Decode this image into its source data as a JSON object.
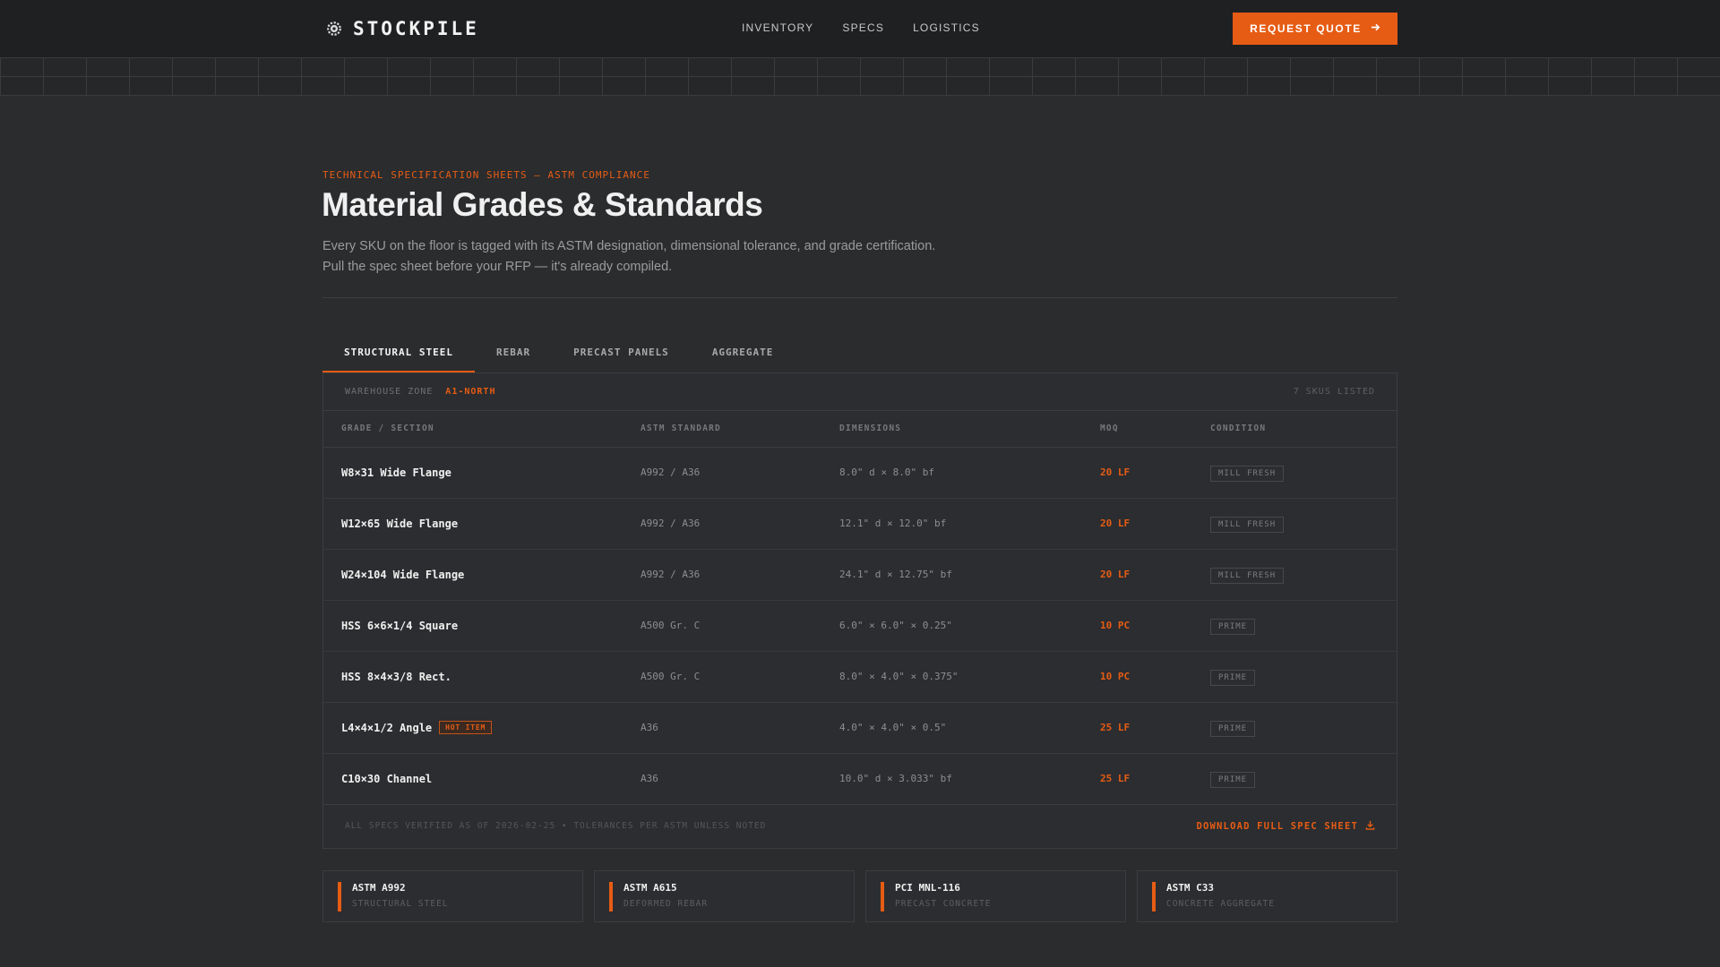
{
  "header": {
    "brand": "STOCKPILE",
    "brand_icon": "gear-icon",
    "nav": [
      "INVENTORY",
      "SPECS",
      "LOGISTICS"
    ],
    "cta_label": "REQUEST QUOTE",
    "cta_icon": "arrow-right-icon"
  },
  "hero": {
    "eyebrow": "TECHNICAL SPECIFICATION SHEETS — ASTM COMPLIANCE",
    "title": "Material Grades & Standards",
    "lead_line1": "Every SKU on the floor is tagged with its ASTM designation, dimensional tolerance, and grade certification.",
    "lead_line2": "Pull the spec sheet before your RFP — it's already compiled."
  },
  "tabs": [
    "STRUCTURAL STEEL",
    "REBAR",
    "PRECAST PANELS",
    "AGGREGATE"
  ],
  "active_tab": 0,
  "zone": {
    "label": "WAREHOUSE ZONE",
    "value": "A1-NORTH",
    "count": "7 SKUS LISTED"
  },
  "table": {
    "columns": [
      "GRADE / SECTION",
      "ASTM STANDARD",
      "DIMENSIONS",
      "MOQ",
      "CONDITION"
    ],
    "rows": [
      {
        "grade": "W8×31 Wide Flange",
        "badge": "",
        "astm": "A992 / A36",
        "dims": "8.0\" d × 8.0\" bf",
        "moq": "20 LF",
        "condition": "MILL FRESH"
      },
      {
        "grade": "W12×65 Wide Flange",
        "badge": "",
        "astm": "A992 / A36",
        "dims": "12.1\" d × 12.0\" bf",
        "moq": "20 LF",
        "condition": "MILL FRESH"
      },
      {
        "grade": "W24×104 Wide Flange",
        "badge": "",
        "astm": "A992 / A36",
        "dims": "24.1\" d × 12.75\" bf",
        "moq": "20 LF",
        "condition": "MILL FRESH"
      },
      {
        "grade": "HSS 6×6×1/4 Square",
        "badge": "",
        "astm": "A500 Gr. C",
        "dims": "6.0\" × 6.0\" × 0.25\"",
        "moq": "10 PC",
        "condition": "PRIME"
      },
      {
        "grade": "HSS 8×4×3/8 Rect.",
        "badge": "",
        "astm": "A500 Gr. C",
        "dims": "8.0\" × 4.0\" × 0.375\"",
        "moq": "10 PC",
        "condition": "PRIME"
      },
      {
        "grade": "L4×4×1/2 Angle",
        "badge": "HOT ITEM",
        "astm": "A36",
        "dims": "4.0\" × 4.0\" × 0.5\"",
        "moq": "25 LF",
        "condition": "PRIME"
      },
      {
        "grade": "C10×30 Channel",
        "badge": "",
        "astm": "A36",
        "dims": "10.0\" d × 3.033\" bf",
        "moq": "25 LF",
        "condition": "PRIME"
      }
    ]
  },
  "footer": {
    "note": "ALL SPECS VERIFIED AS OF 2026-02-25 • TOLERANCES PER ASTM UNLESS NOTED",
    "download_label": "DOWNLOAD FULL SPEC SHEET",
    "download_icon": "download-icon"
  },
  "standards": [
    {
      "code": "ASTM A992",
      "desc": "STRUCTURAL STEEL"
    },
    {
      "code": "ASTM A615",
      "desc": "DEFORMED REBAR"
    },
    {
      "code": "PCI MNL-116",
      "desc": "PRECAST CONCRETE"
    },
    {
      "code": "ASTM C33",
      "desc": "CONCRETE AGGREGATE"
    }
  ],
  "colors": {
    "accent": "#e65c14",
    "background": "#2b2c2e",
    "header": "#1f2022"
  }
}
